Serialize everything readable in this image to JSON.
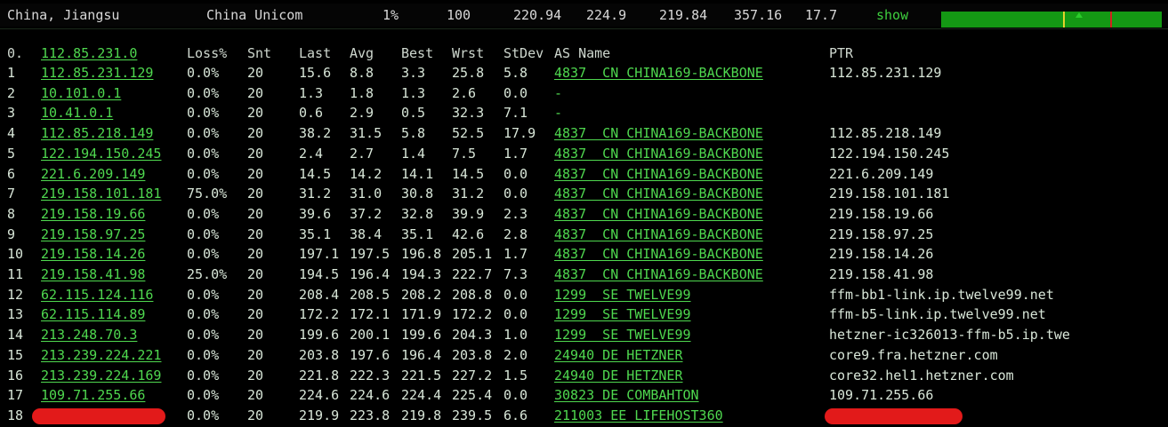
{
  "summary": {
    "location": "China, Jiangsu",
    "isp": "China Unicom",
    "loss": "1%",
    "sent": "100",
    "last": "220.94",
    "avg": "224.9",
    "best": "219.84",
    "worst": "357.16",
    "stdev": "17.7",
    "show_label": "show",
    "graph_colors": {
      "background": "#149914",
      "marker_yellow": "#e2d22b",
      "marker_red": "#d42020"
    }
  },
  "table": {
    "headers": {
      "hop": "0.",
      "host": "112.85.231.0",
      "loss": "Loss%",
      "snt": "Snt",
      "last": "Last",
      "avg": "Avg",
      "best": "Best",
      "wrst": "Wrst",
      "stdev": "StDev",
      "asname": "AS Name",
      "ptr": "PTR"
    },
    "rows": [
      {
        "hop": "1",
        "host": "112.85.231.129",
        "loss": "0.0%",
        "snt": "20",
        "last": "15.6",
        "avg": "8.8",
        "best": "3.3",
        "wrst": "25.8",
        "stdev": "5.8",
        "asname": "4837  CN CHINA169-BACKBONE",
        "ptr": "112.85.231.129"
      },
      {
        "hop": "2",
        "host": "10.101.0.1",
        "loss": "0.0%",
        "snt": "20",
        "last": "1.3",
        "avg": "1.8",
        "best": "1.3",
        "wrst": "2.6",
        "stdev": "0.0",
        "asname": "-",
        "ptr": ""
      },
      {
        "hop": "3",
        "host": "10.41.0.1",
        "loss": "0.0%",
        "snt": "20",
        "last": "0.6",
        "avg": "2.9",
        "best": "0.5",
        "wrst": "32.3",
        "stdev": "7.1",
        "asname": "-",
        "ptr": ""
      },
      {
        "hop": "4",
        "host": "112.85.218.149",
        "loss": "0.0%",
        "snt": "20",
        "last": "38.2",
        "avg": "31.5",
        "best": "5.8",
        "wrst": "52.5",
        "stdev": "17.9",
        "asname": "4837  CN CHINA169-BACKBONE",
        "ptr": "112.85.218.149"
      },
      {
        "hop": "5",
        "host": "122.194.150.245",
        "loss": "0.0%",
        "snt": "20",
        "last": "2.4",
        "avg": "2.7",
        "best": "1.4",
        "wrst": "7.5",
        "stdev": "1.7",
        "asname": "4837  CN CHINA169-BACKBONE",
        "ptr": "122.194.150.245"
      },
      {
        "hop": "6",
        "host": "221.6.209.149",
        "loss": "0.0%",
        "snt": "20",
        "last": "14.5",
        "avg": "14.2",
        "best": "14.1",
        "wrst": "14.5",
        "stdev": "0.0",
        "asname": "4837  CN CHINA169-BACKBONE",
        "ptr": "221.6.209.149"
      },
      {
        "hop": "7",
        "host": "219.158.101.181",
        "loss": "75.0%",
        "snt": "20",
        "last": "31.2",
        "avg": "31.0",
        "best": "30.8",
        "wrst": "31.2",
        "stdev": "0.0",
        "asname": "4837  CN CHINA169-BACKBONE",
        "ptr": "219.158.101.181"
      },
      {
        "hop": "8",
        "host": "219.158.19.66",
        "loss": "0.0%",
        "snt": "20",
        "last": "39.6",
        "avg": "37.2",
        "best": "32.8",
        "wrst": "39.9",
        "stdev": "2.3",
        "asname": "4837  CN CHINA169-BACKBONE",
        "ptr": "219.158.19.66"
      },
      {
        "hop": "9",
        "host": "219.158.97.25",
        "loss": "0.0%",
        "snt": "20",
        "last": "35.1",
        "avg": "38.4",
        "best": "35.1",
        "wrst": "42.6",
        "stdev": "2.8",
        "asname": "4837  CN CHINA169-BACKBONE",
        "ptr": "219.158.97.25"
      },
      {
        "hop": "10",
        "host": "219.158.14.26",
        "loss": "0.0%",
        "snt": "20",
        "last": "197.1",
        "avg": "197.5",
        "best": "196.8",
        "wrst": "205.1",
        "stdev": "1.7",
        "asname": "4837  CN CHINA169-BACKBONE",
        "ptr": "219.158.14.26"
      },
      {
        "hop": "11",
        "host": "219.158.41.98",
        "loss": "25.0%",
        "snt": "20",
        "last": "194.5",
        "avg": "196.4",
        "best": "194.3",
        "wrst": "222.7",
        "stdev": "7.3",
        "asname": "4837  CN CHINA169-BACKBONE",
        "ptr": "219.158.41.98"
      },
      {
        "hop": "12",
        "host": "62.115.124.116",
        "loss": "0.0%",
        "snt": "20",
        "last": "208.4",
        "avg": "208.5",
        "best": "208.2",
        "wrst": "208.8",
        "stdev": "0.0",
        "asname": "1299  SE TWELVE99",
        "ptr": "ffm-bb1-link.ip.twelve99.net"
      },
      {
        "hop": "13",
        "host": "62.115.114.89",
        "loss": "0.0%",
        "snt": "20",
        "last": "172.2",
        "avg": "172.1",
        "best": "171.9",
        "wrst": "172.2",
        "stdev": "0.0",
        "asname": "1299  SE TWELVE99",
        "ptr": "ffm-b5-link.ip.twelve99.net"
      },
      {
        "hop": "14",
        "host": "213.248.70.3",
        "loss": "0.0%",
        "snt": "20",
        "last": "199.6",
        "avg": "200.1",
        "best": "199.6",
        "wrst": "204.3",
        "stdev": "1.0",
        "asname": "1299  SE TWELVE99",
        "ptr": "hetzner-ic326013-ffm-b5.ip.twe"
      },
      {
        "hop": "15",
        "host": "213.239.224.221",
        "loss": "0.0%",
        "snt": "20",
        "last": "203.8",
        "avg": "197.6",
        "best": "196.4",
        "wrst": "203.8",
        "stdev": "2.0",
        "asname": "24940 DE HETZNER",
        "ptr": "core9.fra.hetzner.com"
      },
      {
        "hop": "16",
        "host": "213.239.224.169",
        "loss": "0.0%",
        "snt": "20",
        "last": "221.8",
        "avg": "222.3",
        "best": "221.5",
        "wrst": "227.2",
        "stdev": "1.5",
        "asname": "24940 DE HETZNER",
        "ptr": "core32.hel1.hetzner.com"
      },
      {
        "hop": "17",
        "host": "109.71.255.66",
        "loss": "0.0%",
        "snt": "20",
        "last": "224.6",
        "avg": "224.6",
        "best": "224.4",
        "wrst": "225.4",
        "stdev": "0.0",
        "asname": "30823 DE COMBAHTON",
        "ptr": "109.71.255.66"
      },
      {
        "hop": "18",
        "host": "",
        "loss": "0.0%",
        "snt": "20",
        "last": "219.9",
        "avg": "223.8",
        "best": "219.8",
        "wrst": "239.5",
        "stdev": "6.6",
        "asname": "211003 EE LIFEHOST360",
        "ptr": ""
      }
    ]
  },
  "colors": {
    "accent_green": "#4fd84f",
    "redaction": "#e21a1a"
  }
}
